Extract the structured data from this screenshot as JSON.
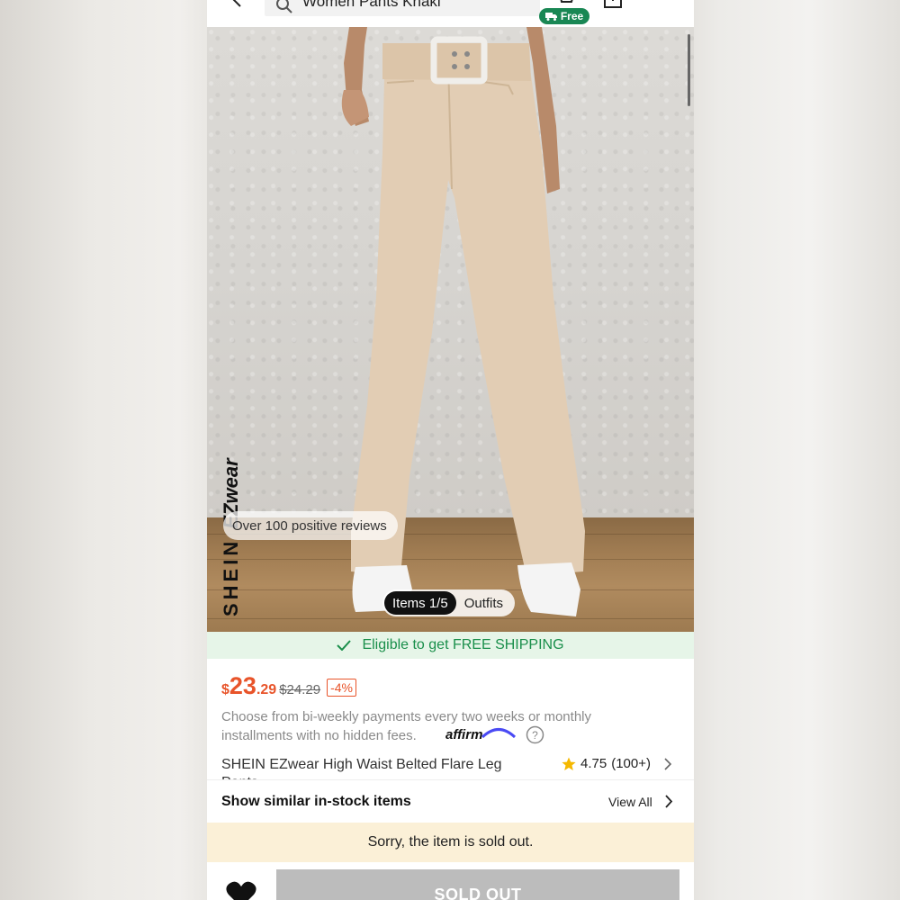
{
  "search": {
    "text": "Women Pants Khaki"
  },
  "header": {
    "free_badge": "Free"
  },
  "gallery": {
    "reviews_tag": "Over 100 positive reviews",
    "brand_text": "SHEIN",
    "brand_suffix": "EZwear",
    "tabs": [
      {
        "label": "Items 1/5",
        "active": true
      },
      {
        "label": "Outfits",
        "active": false
      }
    ]
  },
  "shipping": {
    "text": "Eligible to get FREE SHIPPING"
  },
  "price": {
    "currency": "$",
    "main": "23",
    "cents": ".29",
    "original": "$24.29",
    "discount": "-4%"
  },
  "installment": {
    "text": "Choose from bi-weekly payments every two weeks or monthly installments with no hidden fees.",
    "provider": "affirm"
  },
  "product": {
    "title": "SHEIN EZwear High Waist Belted Flare Leg",
    "title_cont": "Pants",
    "rating": "4.75",
    "review_count": "(100+)"
  },
  "similar": {
    "title": "Show similar in-stock items",
    "view_all": "View All"
  },
  "status": {
    "sold_out_message": "Sorry, the item is sold out."
  },
  "bottom": {
    "button": "SOLD OUT"
  },
  "colors": {
    "accent_price": "#e8542a",
    "free_green": "#198754",
    "shipping_green": "#1a8f4b",
    "sold_out_bg": "#fbf0d7"
  }
}
